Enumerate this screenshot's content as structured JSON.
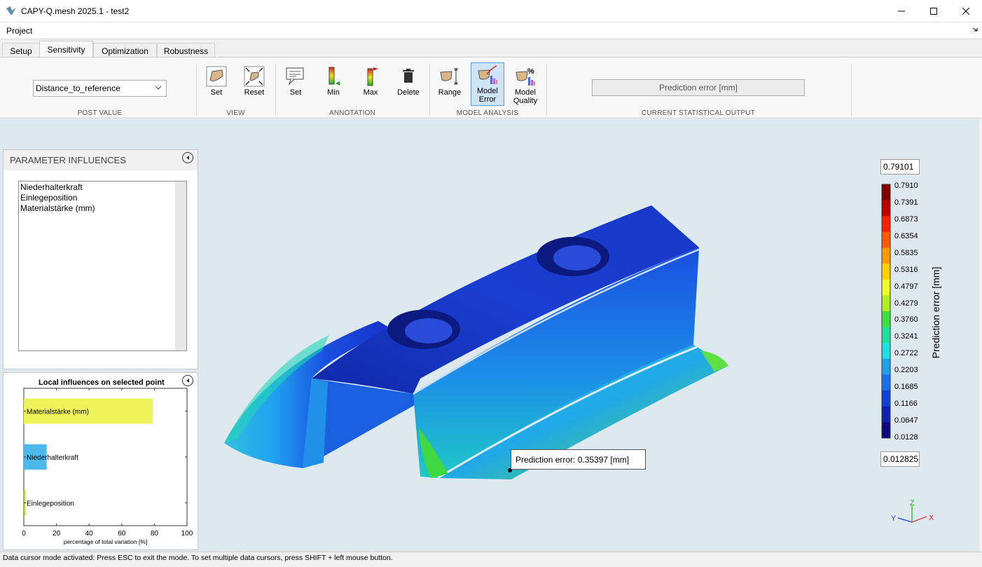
{
  "window": {
    "title": "CAPY-Q.mesh 2025.1 - test2"
  },
  "menu": {
    "project": "Project"
  },
  "tabs": [
    {
      "label": "Setup"
    },
    {
      "label": "Sensitivity"
    },
    {
      "label": "Optimization"
    },
    {
      "label": "Robustness"
    }
  ],
  "toolbar": {
    "post_value": {
      "selected": "Distance_to_reference",
      "group": "POST VALUE"
    },
    "view": {
      "set": "Set",
      "reset": "Reset",
      "group": "VIEW"
    },
    "annotation": {
      "set": "Set",
      "min": "Min",
      "max": "Max",
      "delete": "Delete",
      "group": "ANNOTATION"
    },
    "model_analysis": {
      "range": "Range",
      "model_error_1": "Model",
      "model_error_2": "Error",
      "model_quality_1": "Model",
      "model_quality_2": "Quality",
      "group": "MODEL ANALYSIS"
    },
    "statistical_output": {
      "value": "Prediction error [mm]",
      "group": "CURRENT STATISTICAL OUTPUT"
    }
  },
  "parameter_influences": {
    "title": "PARAMETER INFLUENCES",
    "items": [
      "Niederhalterkraft",
      "Einlegeposition",
      "Materialstärke (mm)"
    ]
  },
  "chart_data": {
    "type": "bar",
    "title": "Local influences on selected point",
    "categories": [
      "Materialstärke (mm)",
      "Niederhalterkraft",
      "Einlegeposition"
    ],
    "values": [
      79,
      14,
      1
    ],
    "colors": [
      "#eef35a",
      "#4db8ec",
      "#a8e03a"
    ],
    "xlabel": "percentage of total variation [%]",
    "xlim": [
      0,
      100
    ],
    "xticks": [
      "0",
      "20",
      "40",
      "60",
      "80",
      "100"
    ]
  },
  "colorbar": {
    "max_box": "0.79101",
    "min_box": "0.012825",
    "title": "Prediction error [mm]",
    "ticks": [
      "0.7910",
      "0.7391",
      "0.6873",
      "0.6354",
      "0.5835",
      "0.5316",
      "0.4797",
      "0.4279",
      "0.3760",
      "0.3241",
      "0.2722",
      "0.2203",
      "0.1685",
      "0.1166",
      "0.0647",
      "0.0128"
    ],
    "colors": [
      "#800000",
      "#c00000",
      "#ff2000",
      "#ff5a00",
      "#ff9a00",
      "#ffd000",
      "#f0ff20",
      "#b0f020",
      "#40e040",
      "#20e0a0",
      "#20e0e0",
      "#20a0e8",
      "#1a70e8",
      "#1040d8",
      "#1020b0",
      "#0a0a80"
    ]
  },
  "tooltip": {
    "text": "Prediction error: 0.35397 [mm]"
  },
  "axes_triad": {
    "z": "Z",
    "y": "Y",
    "x": "X"
  },
  "status": {
    "message": "Data cursor mode activated: Press ESC to exit the mode. To set multiple data cursors, press SHIFT + left mouse button."
  }
}
